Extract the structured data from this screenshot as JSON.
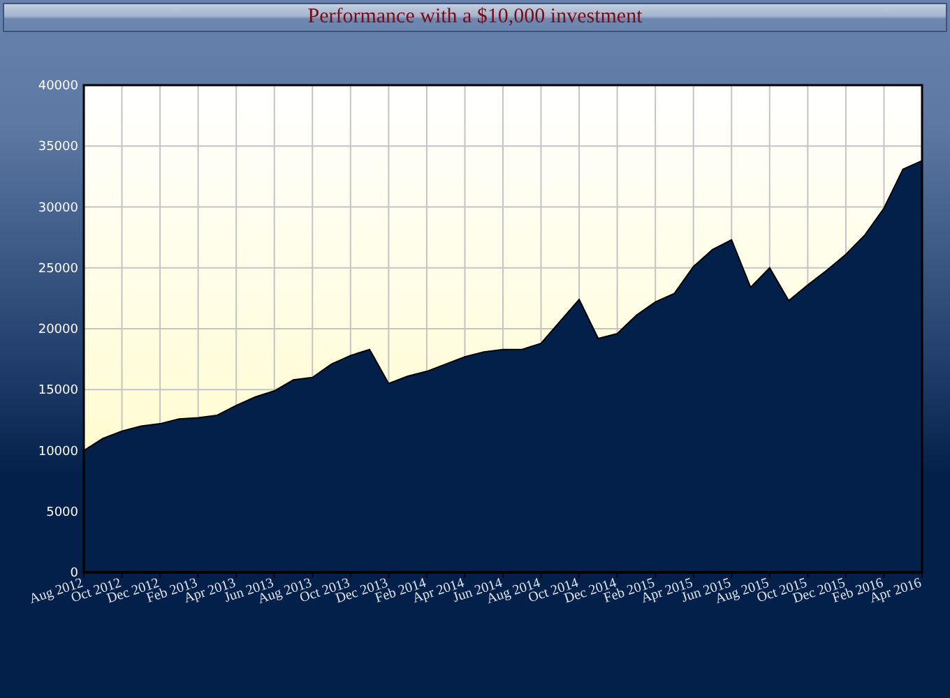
{
  "chart_data": {
    "type": "area",
    "title": "Performance with a $10,000 investment",
    "categories": [
      "Aug 2012",
      null,
      "Oct 2012",
      null,
      "Dec 2012",
      null,
      "Feb 2013",
      null,
      "Apr 2013",
      null,
      "Jun 2013",
      null,
      "Aug 2013",
      null,
      "Oct 2013",
      null,
      "Dec 2013",
      null,
      "Feb 2014",
      null,
      "Apr 2014",
      null,
      "Jun 2014",
      null,
      "Aug 2014",
      null,
      "Oct 2014",
      null,
      "Dec 2014",
      null,
      "Feb 2015",
      null,
      "Apr 2015",
      null,
      "Jun 2015",
      null,
      "Aug 2015",
      null,
      "Oct 2015",
      null,
      "Dec 2015",
      null,
      "Feb 2016",
      null,
      "Apr 2016"
    ],
    "series": [
      {
        "color": "#03204a",
        "values": [
          10000,
          11000,
          11600,
          12000,
          12200,
          12600,
          12700,
          12900,
          13700,
          14400,
          14900,
          15800,
          16000,
          17100,
          17800,
          18300,
          15500,
          16100,
          16500,
          17100,
          17700,
          18100,
          18300,
          18300,
          18800,
          20600,
          22400,
          19200,
          19600,
          21100,
          22200,
          22900,
          25100,
          26500,
          27300,
          23400,
          25000,
          22300,
          23600,
          24800,
          26100,
          27700,
          29900,
          33100,
          33800
        ]
      }
    ],
    "ylim": [
      0,
      40000
    ],
    "grid": true,
    "yticks": [
      0,
      5000,
      10000,
      15000,
      20000,
      25000,
      30000,
      35000,
      40000
    ]
  }
}
